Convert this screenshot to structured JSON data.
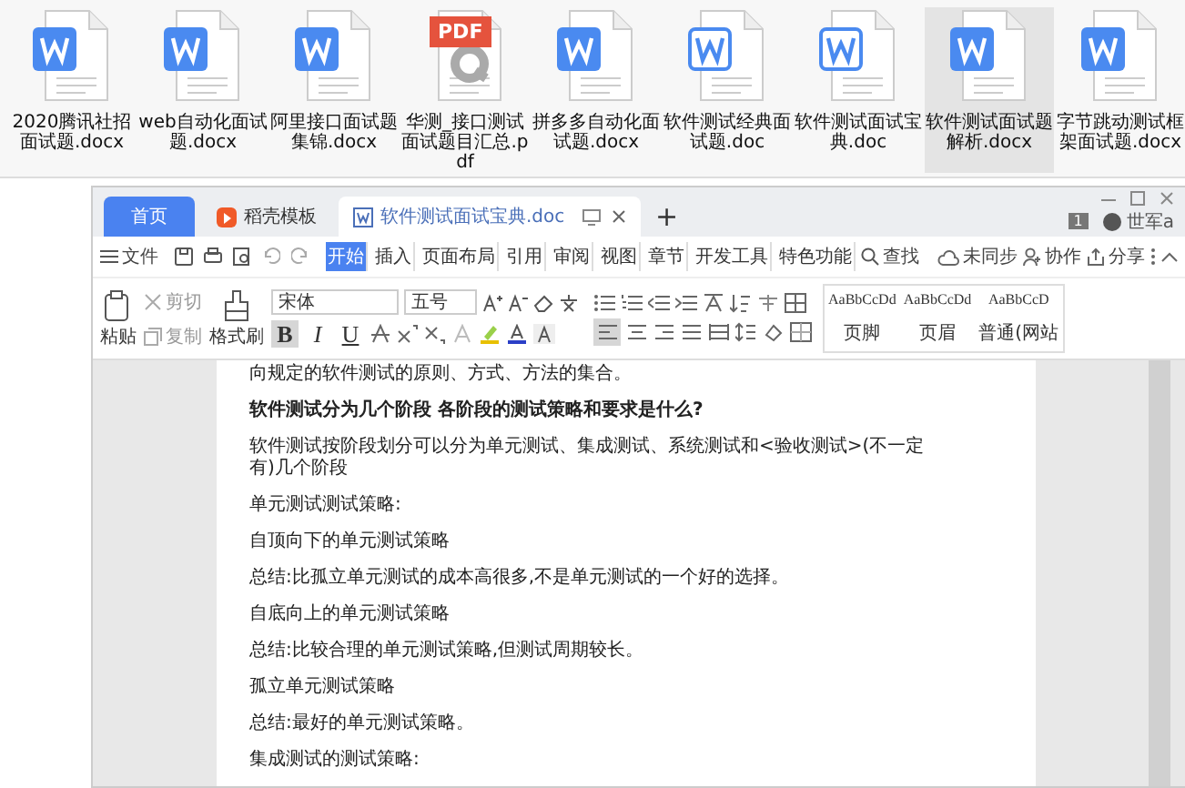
{
  "files": [
    {
      "name": "2020腾讯社招面试题.docx",
      "kind": "word",
      "selected": false
    },
    {
      "name": "web自动化面试题.docx",
      "kind": "word",
      "selected": false
    },
    {
      "name": "阿里接口面试题集锦.docx",
      "kind": "word",
      "selected": false
    },
    {
      "name": "华测_接口测试面试题目汇总.pdf",
      "kind": "pdf",
      "badge": "PDF",
      "selected": false
    },
    {
      "name": "拼多多自动化面试题.docx",
      "kind": "word",
      "selected": false
    },
    {
      "name": "软件测试经典面试题.doc",
      "kind": "word-outline",
      "selected": false
    },
    {
      "name": "软件测试面试宝典.doc",
      "kind": "word-outline",
      "selected": false
    },
    {
      "name": "软件测试面试题解析.docx",
      "kind": "word",
      "selected": true
    },
    {
      "name": "字节跳动测试框架面试题.docx",
      "kind": "word",
      "selected": false
    }
  ],
  "window": {
    "tabs": [
      {
        "label": "首页",
        "kind": "home",
        "selected": false
      },
      {
        "label": "稻壳模板",
        "kind": "template",
        "selected": false
      },
      {
        "label": "软件测试面试宝典.doc",
        "kind": "doc",
        "selected": true
      }
    ],
    "new_tab": "+",
    "badge": "1",
    "user": "世军a",
    "file_menu": "文件",
    "menu_tabs": [
      {
        "label": "开始",
        "selected": true
      },
      {
        "label": "插入",
        "selected": false
      },
      {
        "label": "页面布局",
        "selected": false
      },
      {
        "label": "引用",
        "selected": false
      },
      {
        "label": "审阅",
        "selected": false
      },
      {
        "label": "视图",
        "selected": false
      },
      {
        "label": "章节",
        "selected": false
      },
      {
        "label": "开发工具",
        "selected": false
      },
      {
        "label": "特色功能",
        "selected": false
      }
    ],
    "search": "查找",
    "sync": "未同步",
    "collab": "协作",
    "share": "分享",
    "ribbon": {
      "paste": "粘贴",
      "cut": "剪切",
      "copy": "复制",
      "format_painter": "格式刷",
      "font": "宋体",
      "size": "五号",
      "bold": {
        "label": "B",
        "active": true
      },
      "italic": {
        "label": "I",
        "active": false
      },
      "underline": {
        "label": "U",
        "active": false
      },
      "align_left_active": true,
      "styles": [
        {
          "preview": "AaBbCcDd",
          "name": "页脚"
        },
        {
          "preview": "AaBbCcDd",
          "name": "页眉"
        },
        {
          "preview": "AaBbCcD",
          "name": "普通(网站"
        }
      ]
    }
  },
  "document": {
    "paragraphs": [
      {
        "kind": "body",
        "text": "向规定的软件测试的原则、方式、方法的集合。"
      },
      {
        "kind": "heading",
        "text": "软件测试分为几个阶段 各阶段的测试策略和要求是什么?"
      },
      {
        "kind": "body",
        "text": "软件测试按阶段划分可以分为单元测试、集成测试、系统测试和<验收测试>(不一定有)几个阶段"
      },
      {
        "kind": "body",
        "text": "单元测试测试策略:"
      },
      {
        "kind": "body",
        "text": "自顶向下的单元测试策略"
      },
      {
        "kind": "body",
        "text": "总结:比孤立单元测试的成本高很多,不是单元测试的一个好的选择。"
      },
      {
        "kind": "body",
        "text": "自底向上的单元测试策略"
      },
      {
        "kind": "body",
        "text": "总结:比较合理的单元测试策略,但测试周期较长。"
      },
      {
        "kind": "body",
        "text": "孤立单元测试策略"
      },
      {
        "kind": "body",
        "text": "总结:最好的单元测试策略。"
      },
      {
        "kind": "body",
        "text": "集成测试的测试策略:"
      }
    ]
  }
}
